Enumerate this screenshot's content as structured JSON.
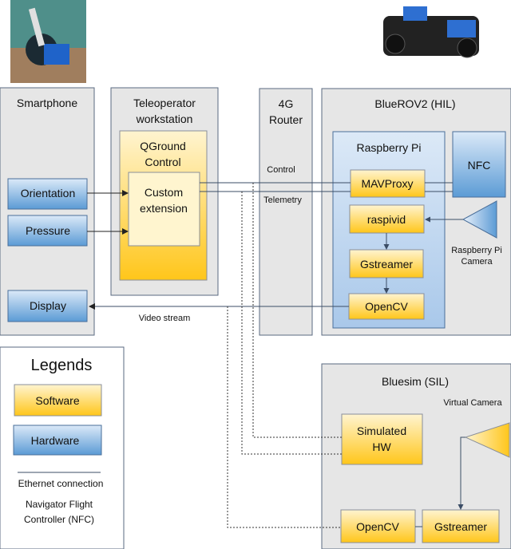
{
  "groups": {
    "smartphone": "Smartphone",
    "teleop": [
      "Teleoperator",
      "workstation"
    ],
    "router": [
      "4G",
      "Router"
    ],
    "bluerov": "BlueROV2 (HIL)",
    "raspberry_pi": "Raspberry Pi",
    "bluesim": "Bluesim (SIL)"
  },
  "nodes": {
    "orientation": "Orientation",
    "pressure": "Pressure",
    "display": "Display",
    "qgc": [
      "QGround",
      "Control"
    ],
    "custom": [
      "Custom",
      "extension"
    ],
    "mavproxy": "MAVProxy",
    "nfc": "NFC",
    "raspivid": "raspivid",
    "gstreamer": "Gstreamer",
    "opencv": "OpenCV",
    "sim_hw": [
      "Simulated",
      "HW"
    ],
    "sim_opencv": "OpenCV",
    "sim_gstreamer": "Gstreamer"
  },
  "labels": {
    "control": "Control",
    "telemetry": "Telemetry",
    "video": "Video stream",
    "rpi_camera": [
      "Raspberry Pi",
      "Camera"
    ],
    "virtual_camera": "Virtual Camera"
  },
  "legend": {
    "title": "Legends",
    "software": "Software",
    "hardware": "Hardware",
    "ethernet": "Ethernet connection",
    "nfc": [
      "Navigator Flight",
      "Controller (NFC)"
    ]
  },
  "colors": {
    "software": "#ffc61a",
    "hardware": "#5b9bd5",
    "group": "#e6e6e6"
  }
}
